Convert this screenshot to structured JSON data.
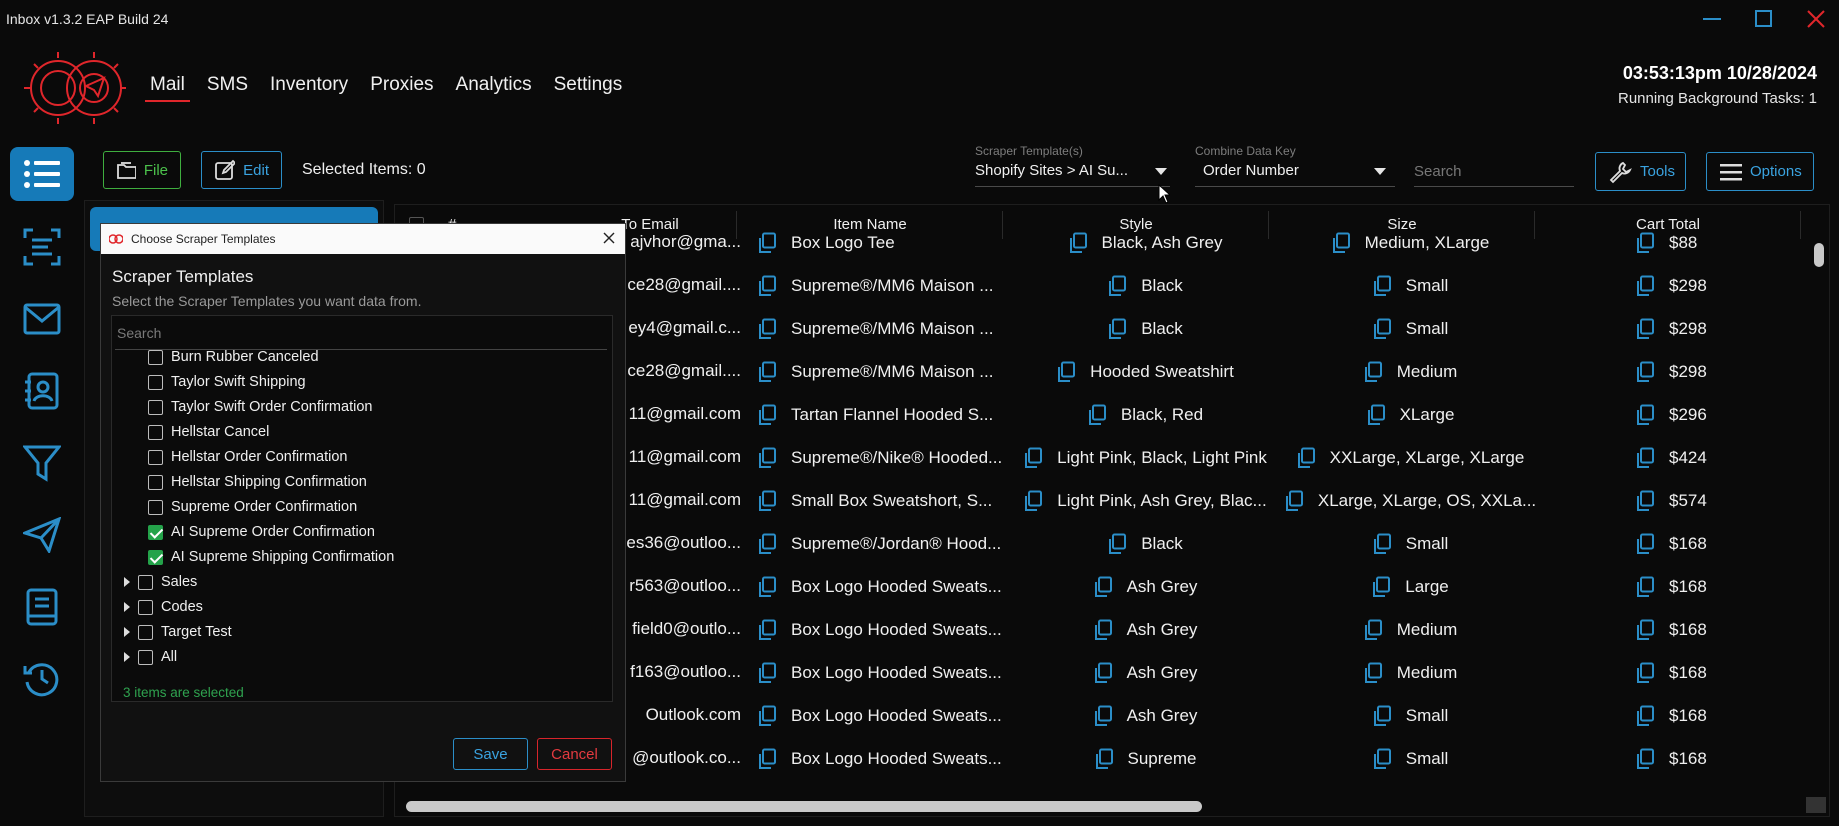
{
  "window": {
    "title": "Inbox v1.3.2 EAP Build 24"
  },
  "nav": [
    {
      "label": "Mail",
      "active": true
    },
    {
      "label": "SMS",
      "active": false
    },
    {
      "label": "Inventory",
      "active": false
    },
    {
      "label": "Proxies",
      "active": false
    },
    {
      "label": "Analytics",
      "active": false
    },
    {
      "label": "Settings",
      "active": false
    }
  ],
  "clock": {
    "time": "03:53:13pm 10/28/2024",
    "tasks": "Running Background Tasks: 1"
  },
  "rail_icons": [
    "list-icon",
    "scan-icon",
    "mail-icon",
    "contacts-icon",
    "filter-icon",
    "send-icon",
    "book-icon",
    "history-icon"
  ],
  "toolbar": {
    "file_label": "File",
    "edit_label": "Edit",
    "selected_items": "Selected Items: 0",
    "scraper_label": "Scraper Template(s)",
    "scraper_value": "Shopify Sites > AI Su...",
    "combine_label": "Combine Data Key",
    "combine_value": "Order Number",
    "search_placeholder": "Search",
    "tools_label": "Tools",
    "options_label": "Options"
  },
  "table": {
    "headers": {
      "num": "#",
      "to_email": "To Email",
      "item_name": "Item Name",
      "style": "Style",
      "size": "Size",
      "cart_total": "Cart Total"
    },
    "rows": [
      {
        "email": "ajvhor@gma...",
        "item": "Box Logo Tee",
        "style": "Black, Ash Grey",
        "size": "Medium, XLarge",
        "total": "$88"
      },
      {
        "email": "ce28@gmail....",
        "item": "Supreme®/MM6 Maison ...",
        "style": "Black",
        "size": "Small",
        "total": "$298"
      },
      {
        "email": "ey4@gmail.c...",
        "item": "Supreme®/MM6 Maison ...",
        "style": "Black",
        "size": "Small",
        "total": "$298"
      },
      {
        "email": "ce28@gmail....",
        "item": "Supreme®/MM6 Maison ...",
        "style": "Hooded Sweatshirt",
        "size": "Medium",
        "total": "$298"
      },
      {
        "email": "11@gmail.com",
        "item": "Tartan Flannel Hooded S...",
        "style": "Black, Red",
        "size": "XLarge",
        "total": "$296"
      },
      {
        "email": "11@gmail.com",
        "item": "Supreme®/Nike® Hooded...",
        "style": "Light Pink, Black, Light Pink",
        "size": "XXLarge, XLarge, XLarge",
        "total": "$424"
      },
      {
        "email": "11@gmail.com",
        "item": "Small Box Sweatshort, S...",
        "style": "Light Pink, Ash Grey, Blac...",
        "size": "XLarge, XLarge, OS, XXLa...",
        "total": "$574"
      },
      {
        "email": "es36@outloo...",
        "item": "Supreme®/Jordan® Hood...",
        "style": "Black",
        "size": "Small",
        "total": "$168"
      },
      {
        "email": "r563@outloo...",
        "item": "Box Logo Hooded Sweats...",
        "style": "Ash Grey",
        "size": "Large",
        "total": "$168"
      },
      {
        "email": "field0@outlo...",
        "item": "Box Logo Hooded Sweats...",
        "style": "Ash Grey",
        "size": "Medium",
        "total": "$168"
      },
      {
        "email": "f163@outloo...",
        "item": "Box Logo Hooded Sweats...",
        "style": "Ash Grey",
        "size": "Medium",
        "total": "$168"
      },
      {
        "email": "Outlook.com",
        "item": "Box Logo Hooded Sweats...",
        "style": "Ash Grey",
        "size": "Small",
        "total": "$168"
      },
      {
        "email": "@outlook.co...",
        "item": "Box Logo Hooded Sweats...",
        "style": "Supreme",
        "size": "Small",
        "total": "$168"
      }
    ]
  },
  "dialog": {
    "title": "Choose Scraper Templates",
    "heading": "Scraper Templates",
    "subtitle": "Select the Scraper Templates you want data from.",
    "search_placeholder": "Search",
    "items": [
      {
        "label": "Burn Rubber Canceled",
        "checked": false
      },
      {
        "label": "Taylor Swift Shipping",
        "checked": false
      },
      {
        "label": "Taylor Swift Order Confirmation",
        "checked": false
      },
      {
        "label": "Hellstar Cancel",
        "checked": false
      },
      {
        "label": "Hellstar Order Confirmation",
        "checked": false
      },
      {
        "label": "Hellstar Shipping Confirmation",
        "checked": false
      },
      {
        "label": "Supreme Order Confirmation",
        "checked": false
      },
      {
        "label": "AI Supreme Order Confirmation",
        "checked": true
      },
      {
        "label": "AI Supreme Shipping Confirmation",
        "checked": true
      }
    ],
    "groups": [
      {
        "label": "Sales",
        "checked": false
      },
      {
        "label": "Codes",
        "checked": false
      },
      {
        "label": "Target Test",
        "checked": false
      },
      {
        "label": "All",
        "checked": false
      }
    ],
    "status": "3 items are selected",
    "save_label": "Save",
    "cancel_label": "Cancel"
  },
  "colors": {
    "accent_blue": "#167ab8",
    "accent_red": "#e0262b",
    "accent_green": "#24a34a"
  }
}
